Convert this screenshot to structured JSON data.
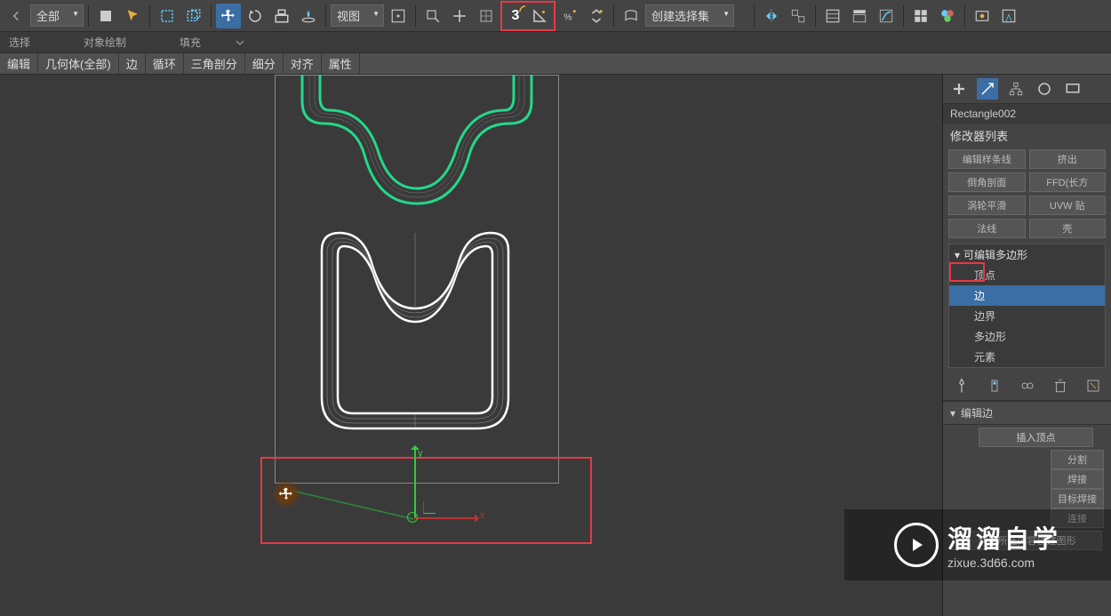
{
  "toolbar": {
    "filter_dropdown": "全部",
    "view_dropdown": "视图",
    "snap_value": "3",
    "selset_dropdown": "创建选择集"
  },
  "toolbar2": {
    "select_label": "选择",
    "draw_label": "对象绘制",
    "fill_label": "填充"
  },
  "tabs": [
    "编辑",
    "几何体(全部)",
    "边",
    "循环",
    "三角剖分",
    "细分",
    "对齐",
    "属性"
  ],
  "object_name": "Rectangle002",
  "modifier_list_label": "修改器列表",
  "mod_buttons": [
    [
      "编辑样条线",
      "挤出"
    ],
    [
      "倒角剖面",
      "FFD(长方"
    ],
    [
      "涡轮平滑",
      "UVW 贴"
    ],
    [
      "法线",
      "壳"
    ]
  ],
  "stack": {
    "head": "可编辑多边形",
    "items": [
      "顶点",
      "边",
      "边界",
      "多边形",
      "元素"
    ],
    "selected_index": 1
  },
  "rollups": {
    "edit_edge": "编辑边",
    "insert_vertex": "插入顶点",
    "split": "分割",
    "weld": "焊接",
    "target_weld": "目标焊接",
    "connect": "连接",
    "use_selected": "利用所选内容创建图形"
  },
  "gizmo": {
    "y": "y",
    "x": "x"
  },
  "watermark": {
    "brand": "溜溜自学",
    "url": "zixue.3d66.com"
  }
}
